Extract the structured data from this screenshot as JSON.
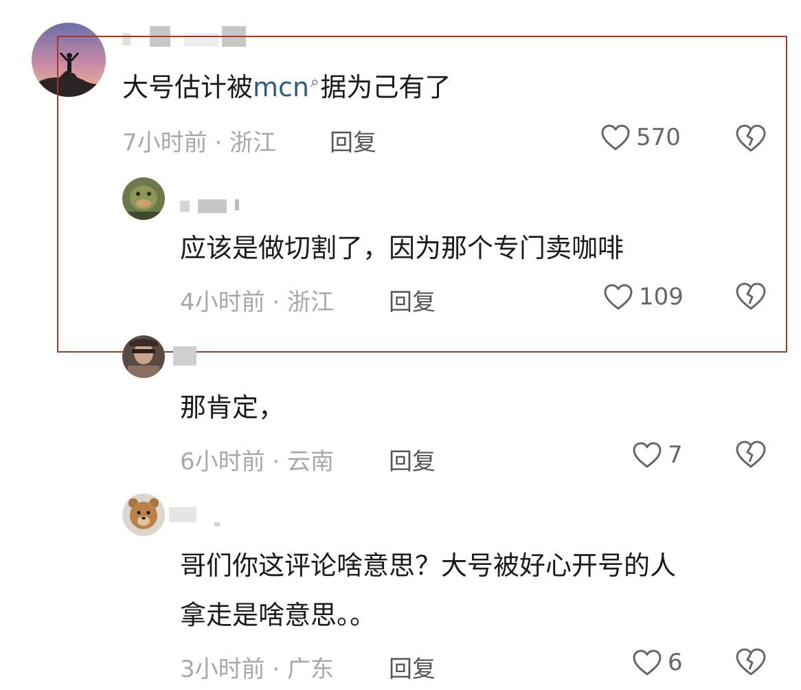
{
  "comments": [
    {
      "text_before": "大号估计被",
      "mention": "mcn",
      "text_after": "据为己有了",
      "time": "7小时前",
      "location": "浙江",
      "meta": "7小时前 · 浙江",
      "reply_label": "回复",
      "likes": "570"
    },
    {
      "text": "应该是做切割了，因为那个专门卖咖啡",
      "time": "4小时前",
      "location": "浙江",
      "meta": "4小时前 · 浙江",
      "reply_label": "回复",
      "likes": "109"
    },
    {
      "text": "那肯定，",
      "time": "6小时前",
      "location": "云南",
      "meta": "6小时前 · 云南",
      "reply_label": "回复",
      "likes": "7"
    },
    {
      "text_line1": "哥们你这评论啥意思？大号被好心开号的人",
      "text_line2": "拿走是啥意思。。",
      "time": "3小时前",
      "location": "广东",
      "meta": "3小时前 · 广东",
      "reply_label": "回复",
      "likes": "6"
    }
  ],
  "icons": {
    "like": "heart-outline-icon",
    "dislike": "broken-heart-icon",
    "mention": "search-icon"
  },
  "colors": {
    "highlight_border": "#a23a2c",
    "mention": "#2a5b8c",
    "meta_gray": "#a8a8a8"
  }
}
